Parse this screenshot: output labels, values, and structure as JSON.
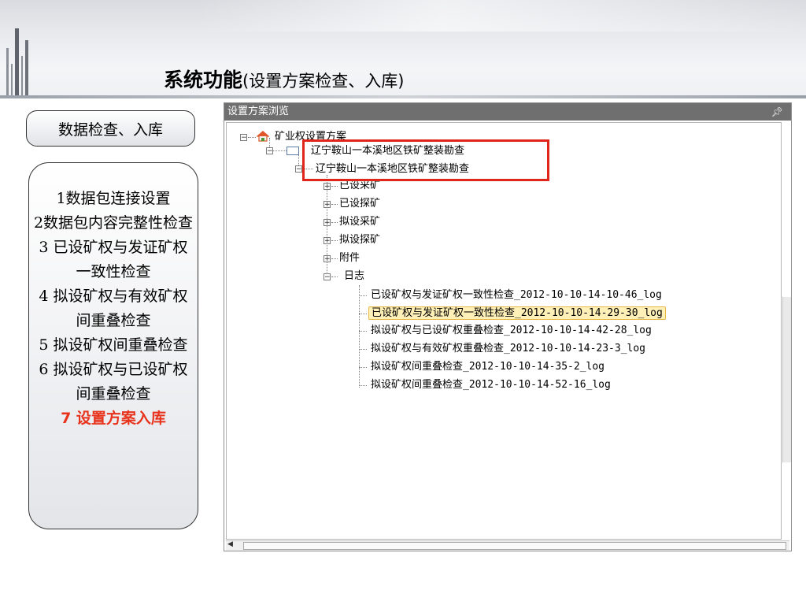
{
  "header": {
    "title_main": "系统功能",
    "title_sub": "(设置方案检查、入库)"
  },
  "section_tag": "数据检查、入库",
  "steps": [
    "1数据包连接设置",
    "2数据包内容完整性检查",
    "3 已设矿权与发证矿权一致性检查",
    "4 拟设矿权与有效矿权间重叠检查",
    "5 拟设矿权间重叠检查",
    "6 拟设矿权与已设矿权间重叠检查",
    "7 设置方案入库"
  ],
  "active_step_index": 6,
  "colors": {
    "active_step": "#e8331c",
    "highlight_border": "#e0261b",
    "panel_header": "#6f6f6f",
    "selected_bg": "#fff0b8"
  },
  "panel": {
    "title": "设置方案浏览",
    "pin_icon": "pin-icon",
    "tree": {
      "root": "矿业权设置方案",
      "plan_1": "辽宁鞍山一本溪地区铁矿整装勘查",
      "plan_2": "辽宁鞍山一本溪地区铁矿整装勘查",
      "categories": [
        "已设采矿",
        "已设探矿",
        "拟设采矿",
        "拟设探矿",
        "附件"
      ],
      "log_folder": "日志",
      "logs": [
        "已设矿权与发证矿权一致性检查_2012-10-10-14-10-46_log",
        "已设矿权与发证矿权一致性检查_2012-10-10-14-29-30_log",
        "拟设矿权与已设矿权重叠检查_2012-10-10-14-42-28_log",
        "拟设矿权与有效矿权重叠检查_2012-10-10-14-23-3_log",
        "拟设矿权间重叠检查_2012-10-10-14-35-2_log",
        "拟设矿权间重叠检查_2012-10-10-14-52-16_log"
      ],
      "selected_log_index": 1
    }
  }
}
